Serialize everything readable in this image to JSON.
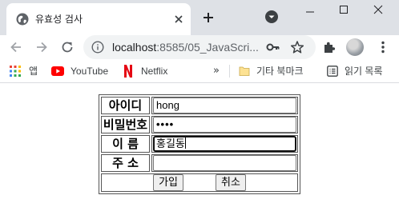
{
  "browser": {
    "tab_title": "유효성 검사",
    "url_host": "localhost",
    "url_path": ":8585/05_JavaScri..."
  },
  "bookmarks": {
    "apps_label": "앱",
    "youtube_label": "YouTube",
    "netflix_label": "Netflix",
    "more_label": "»",
    "other_label": "기타 북마크",
    "reading_label": "읽기 목록"
  },
  "form": {
    "id_label": "아이디",
    "id_value": "hong",
    "pw_label": "비밀번호",
    "pw_value": "••••",
    "name_label": "이 름",
    "name_value": "홍길동",
    "addr_label": "주 소",
    "addr_value": "",
    "join_button": "가입",
    "cancel_button": "취소"
  },
  "colors": {
    "tabstrip_bg": "#dee1e6",
    "omnibox_bg": "#f1f3f4",
    "youtube_red": "#ff0000",
    "netflix_red": "#e50914"
  }
}
